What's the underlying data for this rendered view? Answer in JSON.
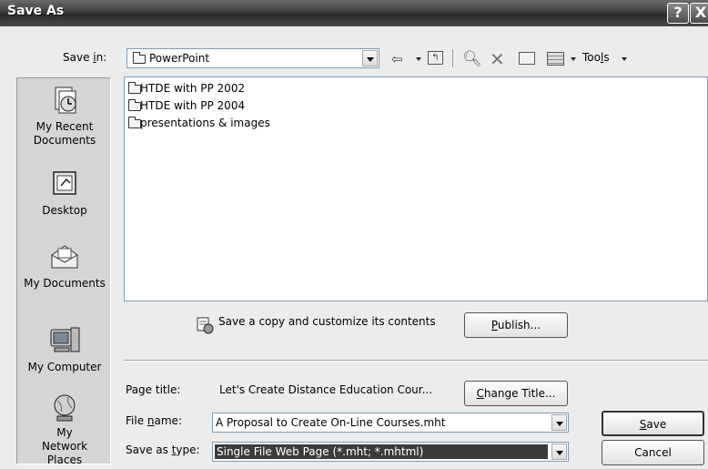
{
  "window": {
    "title": "Save As",
    "help_label": "?",
    "close_label": "X"
  },
  "toolbar": {
    "save_in_label_pre": "Save ",
    "save_in_label_u": "i",
    "save_in_label_post": "n:",
    "save_in_value": "PowerPoint",
    "tools_pre": "Too",
    "tools_u": "l",
    "tools_post": "s"
  },
  "places": [
    {
      "label": "My Recent Documents",
      "icon": "recent-documents-icon"
    },
    {
      "label": "Desktop",
      "icon": "desktop-icon"
    },
    {
      "label": "My Documents",
      "icon": "my-documents-icon"
    },
    {
      "label": "My Computer",
      "icon": "my-computer-icon"
    },
    {
      "label": "My Network Places",
      "icon": "network-places-icon"
    }
  ],
  "files": [
    {
      "name": "HTDE with PP 2002",
      "type": "folder"
    },
    {
      "name": "HTDE with PP 2004",
      "type": "folder"
    },
    {
      "name": "presentations & images",
      "type": "folder"
    }
  ],
  "publish": {
    "text": "Save a copy and customize its contents",
    "button_u": "P",
    "button_post": "ublish..."
  },
  "form": {
    "page_title_label": "Page title:",
    "page_title_value": "Let's Create Distance Education Cour...",
    "change_title_u": "C",
    "change_title_post": "hange Title...",
    "file_name_label_pre": "File ",
    "file_name_label_u": "n",
    "file_name_label_post": "ame:",
    "file_name_value": "A Proposal to Create On-Line Courses.mht",
    "save_type_label_pre": "Save as ",
    "save_type_label_u": "t",
    "save_type_label_post": "ype:",
    "save_type_value": "Single File Web Page (*.mht; *.mhtml)",
    "save_u": "S",
    "save_post": "ave",
    "cancel": "Cancel"
  }
}
